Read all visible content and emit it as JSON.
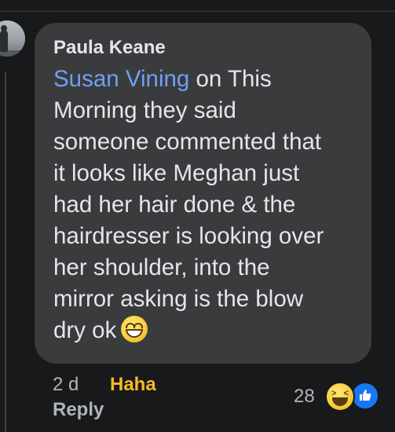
{
  "comment": {
    "author": "Paula Keane",
    "mention": "Susan Vining",
    "text_lines": [
      " on This",
      "Morning they said",
      "someone commented that",
      "it looks like Meghan just",
      "had her hair done & the",
      "hairdresser is looking over",
      "her shoulder, into the",
      "mirror asking is the blow",
      "dry ok"
    ],
    "emoji": "grinning-face-with-smiling-eyes"
  },
  "actions": {
    "time": "2 d",
    "reaction_label": "Haha",
    "reply_label": "Reply"
  },
  "reactions": {
    "count": "28",
    "types": [
      "haha",
      "like"
    ]
  },
  "colors": {
    "background": "#18191a",
    "bubble": "#3a3b3c",
    "mention": "#6f9ff5",
    "haha": "#f7b928",
    "like": "#1877f2"
  }
}
